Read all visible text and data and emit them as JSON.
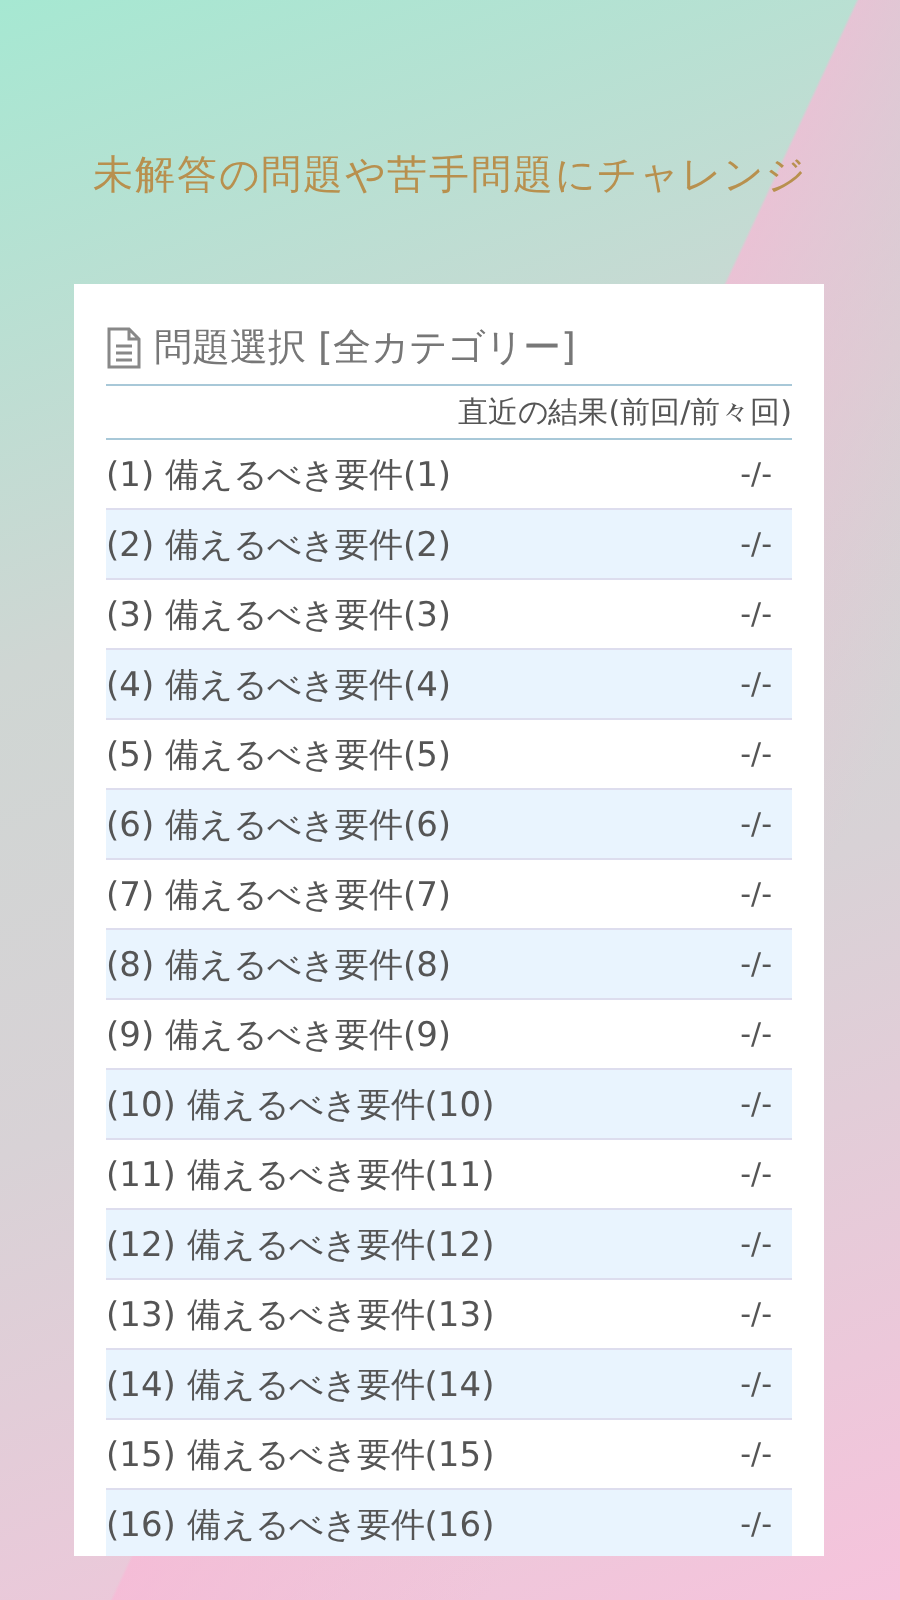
{
  "headline": "未解答の問題や苦手問題にチャレンジ",
  "panel": {
    "title": "問題選択 [全カテゴリー]",
    "column_header": "直近の結果(前回/前々回)",
    "rows": [
      {
        "label": "(1) 備えるべき要件(1)",
        "result": "-/-"
      },
      {
        "label": "(2) 備えるべき要件(2)",
        "result": "-/-"
      },
      {
        "label": "(3) 備えるべき要件(3)",
        "result": "-/-"
      },
      {
        "label": "(4) 備えるべき要件(4)",
        "result": "-/-"
      },
      {
        "label": "(5) 備えるべき要件(5)",
        "result": "-/-"
      },
      {
        "label": "(6) 備えるべき要件(6)",
        "result": "-/-"
      },
      {
        "label": "(7) 備えるべき要件(7)",
        "result": "-/-"
      },
      {
        "label": "(8) 備えるべき要件(8)",
        "result": "-/-"
      },
      {
        "label": "(9) 備えるべき要件(9)",
        "result": "-/-"
      },
      {
        "label": "(10) 備えるべき要件(10)",
        "result": "-/-"
      },
      {
        "label": "(11) 備えるべき要件(11)",
        "result": "-/-"
      },
      {
        "label": "(12) 備えるべき要件(12)",
        "result": "-/-"
      },
      {
        "label": "(13) 備えるべき要件(13)",
        "result": "-/-"
      },
      {
        "label": "(14) 備えるべき要件(14)",
        "result": "-/-"
      },
      {
        "label": "(15) 備えるべき要件(15)",
        "result": "-/-"
      },
      {
        "label": "(16) 備えるべき要件(16)",
        "result": "-/-"
      }
    ]
  }
}
